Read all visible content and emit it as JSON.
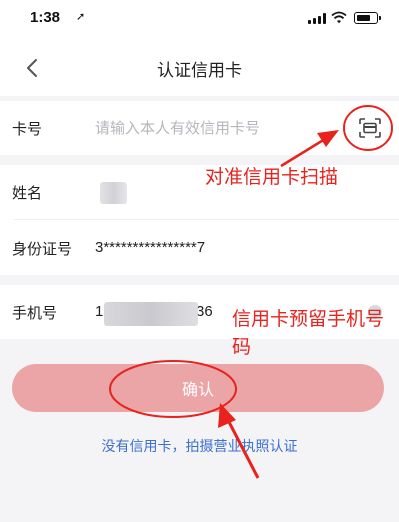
{
  "status_bar": {
    "time": "1:38",
    "location_glyph": "➚"
  },
  "nav": {
    "title": "认证信用卡",
    "back_icon": "chevron-left-icon"
  },
  "form": {
    "card_number": {
      "label": "卡号",
      "placeholder": "请输入本人有效信用卡号",
      "scan_icon": "card-scan-icon"
    },
    "name": {
      "label": "姓名"
    },
    "id_number": {
      "label": "身份证号",
      "value": "3****************7"
    },
    "phone": {
      "label": "手机号",
      "value_prefix": "1",
      "value_suffix": "36"
    }
  },
  "actions": {
    "confirm_label": "确认",
    "alt_link": "没有信用卡，拍摄营业执照认证"
  },
  "annotations": {
    "scan_hint": "对准信用卡扫描",
    "phone_hint": "信用卡预留手机号码"
  },
  "colors": {
    "annotation": "#e8231d",
    "confirm_button": "#eba5a7",
    "link": "#3b6fd0"
  }
}
